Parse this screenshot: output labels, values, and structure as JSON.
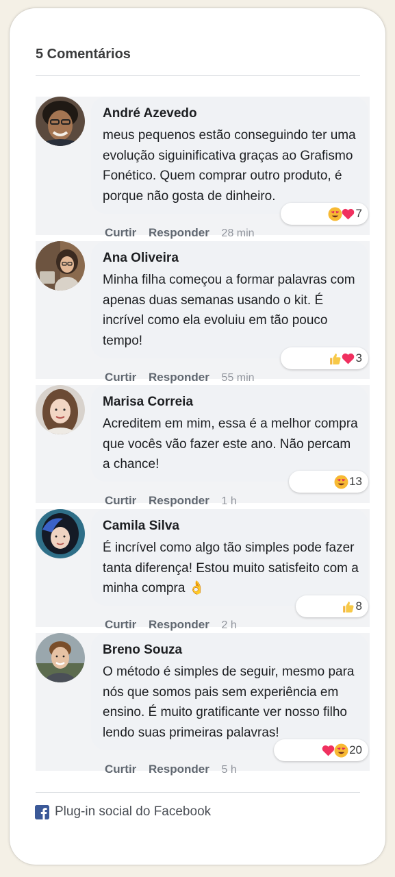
{
  "header": {
    "title": "5 Comentários"
  },
  "actions": {
    "like_label": "Curtir",
    "reply_label": "Responder"
  },
  "comments": [
    {
      "author": "André Azevedo",
      "text": "meus pequenos estão conseguindo ter uma evolução siguinificativa graças ao Grafismo Fonético. Quem comprar outro produto, é porque não gosta de dinheiro.",
      "time": "28 min",
      "reactions": [
        "heart-eyes-emoji",
        "heart-emoji"
      ],
      "reaction_count": "7"
    },
    {
      "author": "Ana Oliveira",
      "text": "Minha filha começou a formar palavras com apenas duas semanas usando o kit. É incrível como ela evoluiu em tão pouco tempo!",
      "time": "55 min",
      "reactions": [
        "thumbs-up-emoji",
        "heart-emoji"
      ],
      "reaction_count": "3"
    },
    {
      "author": "Marisa Correia",
      "text": "Acreditem em mim, essa é a melhor compra que vocês vão fazer este ano. Não percam a chance!",
      "time": "1 h",
      "reactions": [
        "heart-eyes-emoji"
      ],
      "reaction_count": "13"
    },
    {
      "author": "Camila Silva",
      "text": "É incrível como algo tão simples pode fazer tanta diferença! Estou muito satisfeito com a minha compra 👌",
      "time": "2 h",
      "reactions": [
        "thumbs-up-emoji"
      ],
      "reaction_count": "8"
    },
    {
      "author": "Breno Souza",
      "text": "O método é simples de seguir, mesmo para nós que somos pais sem experiência em ensino. É muito gratificante ver nosso filho lendo suas primeiras palavras!",
      "time": "5 h",
      "reactions": [
        "heart-emoji",
        "heart-eyes-emoji"
      ],
      "reaction_count": "20"
    }
  ],
  "footer": {
    "label": "Plug-in social do Facebook"
  },
  "colors": {
    "facebook_blue": "#3b5998",
    "bubble_bg": "#f0f2f5",
    "action_text": "#606770"
  }
}
